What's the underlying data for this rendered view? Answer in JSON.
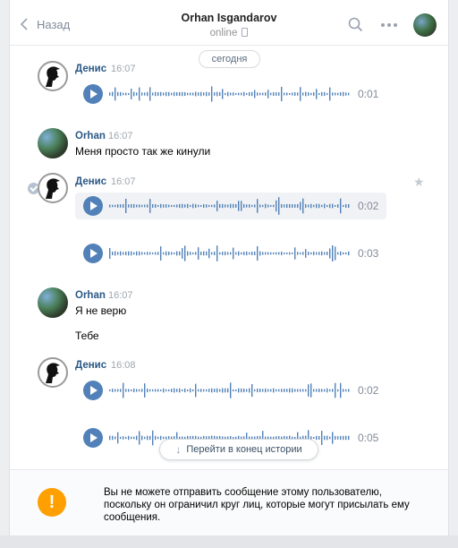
{
  "header": {
    "back_label": "Назад",
    "title": "Orhan Isgandarov",
    "status": "online"
  },
  "date_divider": "сегодня",
  "messages": [
    {
      "author": "Денис",
      "time": "16:07",
      "voice": [
        {
          "duration": "0:01"
        }
      ]
    },
    {
      "author": "Orhan",
      "time": "16:07",
      "text": "Меня просто так же кинули"
    },
    {
      "author": "Денис",
      "time": "16:07",
      "voice": [
        {
          "duration": "0:02"
        },
        {
          "duration": "0:03"
        }
      ]
    },
    {
      "author": "Orhan",
      "time": "16:07",
      "texts": [
        "Я не верю",
        "Тебе"
      ]
    },
    {
      "author": "Денис",
      "time": "16:08",
      "voice": [
        {
          "duration": "0:02"
        },
        {
          "duration": "0:05"
        }
      ]
    }
  ],
  "scroll_button": "Перейти в конец истории",
  "notice": {
    "icon": "!",
    "text": "Вы не можете отправить сообщение этому пользователю, поскольку он ограничил круг лиц, которые могут присылать ему сообщения."
  },
  "colors": {
    "accent": "#5181b8",
    "author": "#2a5885",
    "warning": "#ffa000"
  }
}
